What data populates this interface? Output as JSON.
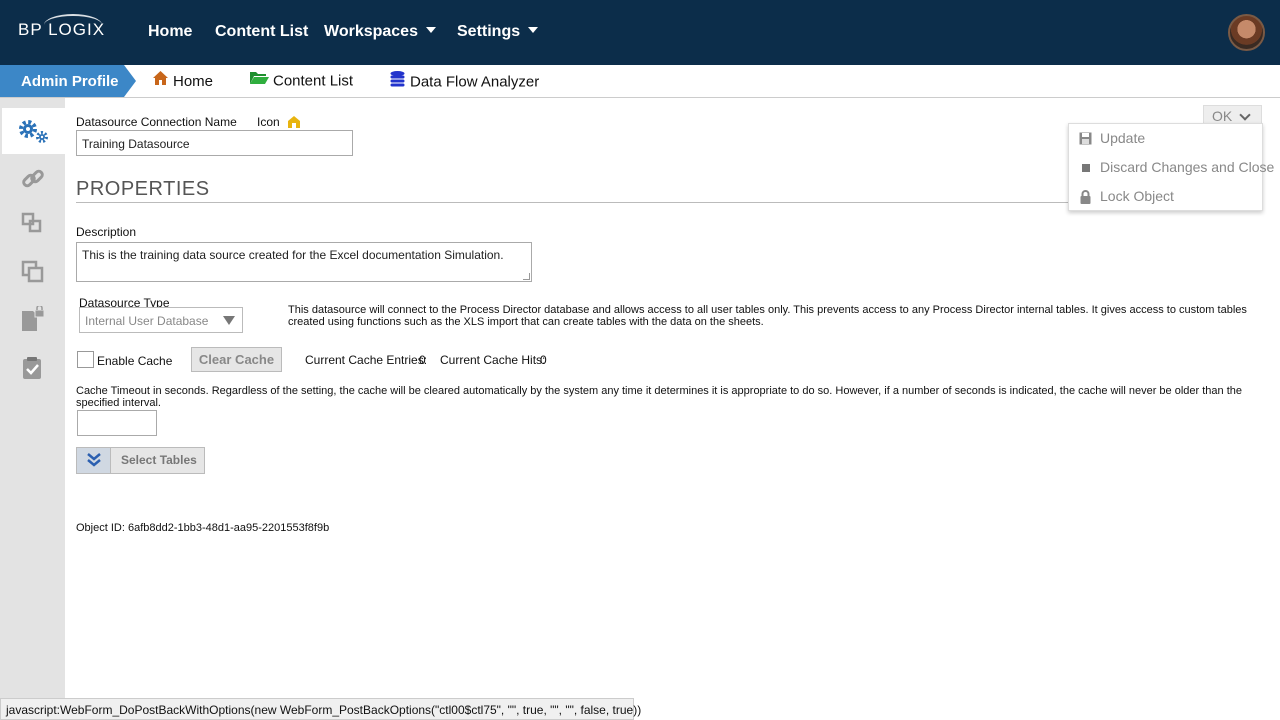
{
  "brand": {
    "logo_text": "BP LOGIX"
  },
  "topnav": {
    "items": [
      {
        "label": "Home"
      },
      {
        "label": "Content List"
      },
      {
        "label": "Workspaces"
      },
      {
        "label": "Settings"
      }
    ]
  },
  "subnav": {
    "active": "Admin Profile",
    "items": [
      {
        "label": "Home",
        "icon": "house-icon"
      },
      {
        "label": "Content List",
        "icon": "folder-icon"
      },
      {
        "label": "Data Flow Analyzer",
        "icon": "database-icon"
      }
    ]
  },
  "form": {
    "conn_name_label": "Datasource Connection Name",
    "icon_label": "Icon",
    "conn_name_value": "Training Datasource",
    "section_title": "PROPERTIES",
    "description_label": "Description",
    "description_value": "This is the training data source created for the Excel documentation Simulation.",
    "type_label": "Datasource Type",
    "type_value": "Internal User Database",
    "type_info": "This datasource will connect to the Process Director database and allows access to all user tables only. This prevents access to any Process Director internal tables. It gives access to custom tables created using functions such as the XLS import that can create tables with the data on the sheets.",
    "enable_cache_label": "Enable Cache",
    "clear_cache_label": "Clear Cache",
    "cache_entries_label": "Current Cache Entries:",
    "cache_entries_value": "0",
    "cache_hits_label": "Current Cache Hits:",
    "cache_hits_value": "0",
    "timeout_label": "Cache Timeout in seconds. Regardless of the setting, the cache will be cleared automatically by the system any time it determines it is appropriate to do so. However, if a number of seconds is indicated, the cache will never be older than the specified interval.",
    "select_tables_label": "Select Tables",
    "object_id_label": "Object ID:",
    "object_id_value": "6afb8dd2-1bb3-48d1-aa95-2201553f8f9b"
  },
  "ok_menu": {
    "button_label": "OK",
    "items": [
      {
        "label": "Update",
        "icon": "save-icon"
      },
      {
        "label": "Discard Changes and Close",
        "icon": "stop-icon"
      },
      {
        "label": "Lock Object",
        "icon": "lock-icon"
      }
    ]
  },
  "statusbar": {
    "text": "javascript:WebForm_DoPostBackWithOptions(new WebForm_PostBackOptions(\"ctl00$ctl75\", \"\", true, \"\", \"\", false, true))"
  },
  "colors": {
    "navbar": "#0c2d4a",
    "accent": "#3c87c7",
    "sidebar_bg": "#e3e3e3",
    "icon_blue": "#2b72b8"
  }
}
